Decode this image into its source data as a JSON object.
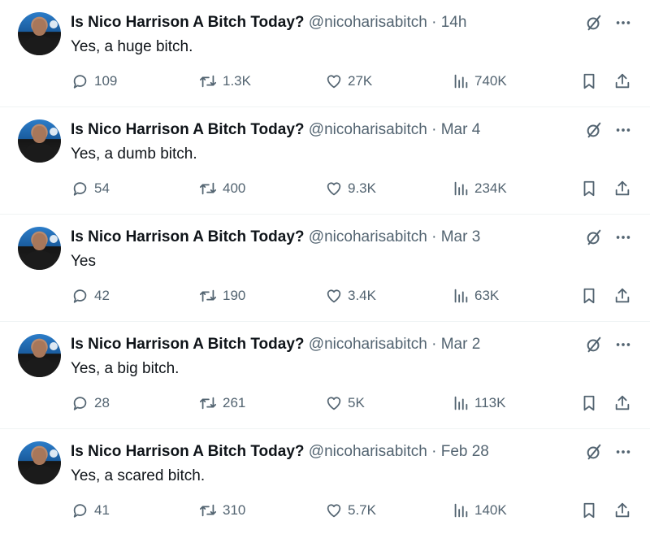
{
  "tweets": [
    {
      "name": "Is Nico Harrison A Bitch Today?",
      "handle": "@nicoharisabitch",
      "separator": "·",
      "time": "14h",
      "text": "Yes, a huge bitch.",
      "replies": "109",
      "retweets": "1.3K",
      "likes": "27K",
      "views": "740K"
    },
    {
      "name": "Is Nico Harrison A Bitch Today?",
      "handle": "@nicoharisabitch",
      "separator": "·",
      "time": "Mar 4",
      "text": "Yes, a dumb bitch.",
      "replies": "54",
      "retweets": "400",
      "likes": "9.3K",
      "views": "234K"
    },
    {
      "name": "Is Nico Harrison A Bitch Today?",
      "handle": "@nicoharisabitch",
      "separator": "·",
      "time": "Mar 3",
      "text": "Yes",
      "replies": "42",
      "retweets": "190",
      "likes": "3.4K",
      "views": "63K"
    },
    {
      "name": "Is Nico Harrison A Bitch Today?",
      "handle": "@nicoharisabitch",
      "separator": "·",
      "time": "Mar 2",
      "text": "Yes, a big bitch.",
      "replies": "28",
      "retweets": "261",
      "likes": "5K",
      "views": "113K"
    },
    {
      "name": "Is Nico Harrison A Bitch Today?",
      "handle": "@nicoharisabitch",
      "separator": "·",
      "time": "Feb 28",
      "text": "Yes, a scared bitch.",
      "replies": "41",
      "retweets": "310",
      "likes": "5.7K",
      "views": "140K"
    }
  ],
  "icons": {
    "grok": "grok-slash-icon",
    "more": "more-dots-icon",
    "reply": "reply-bubble-icon",
    "retweet": "retweet-icon",
    "like": "heart-icon",
    "views": "views-bars-icon",
    "bookmark": "bookmark-icon",
    "share": "share-upload-icon"
  },
  "colors": {
    "text": "#0f1419",
    "secondary": "#536471",
    "divider": "#eff3f4"
  }
}
